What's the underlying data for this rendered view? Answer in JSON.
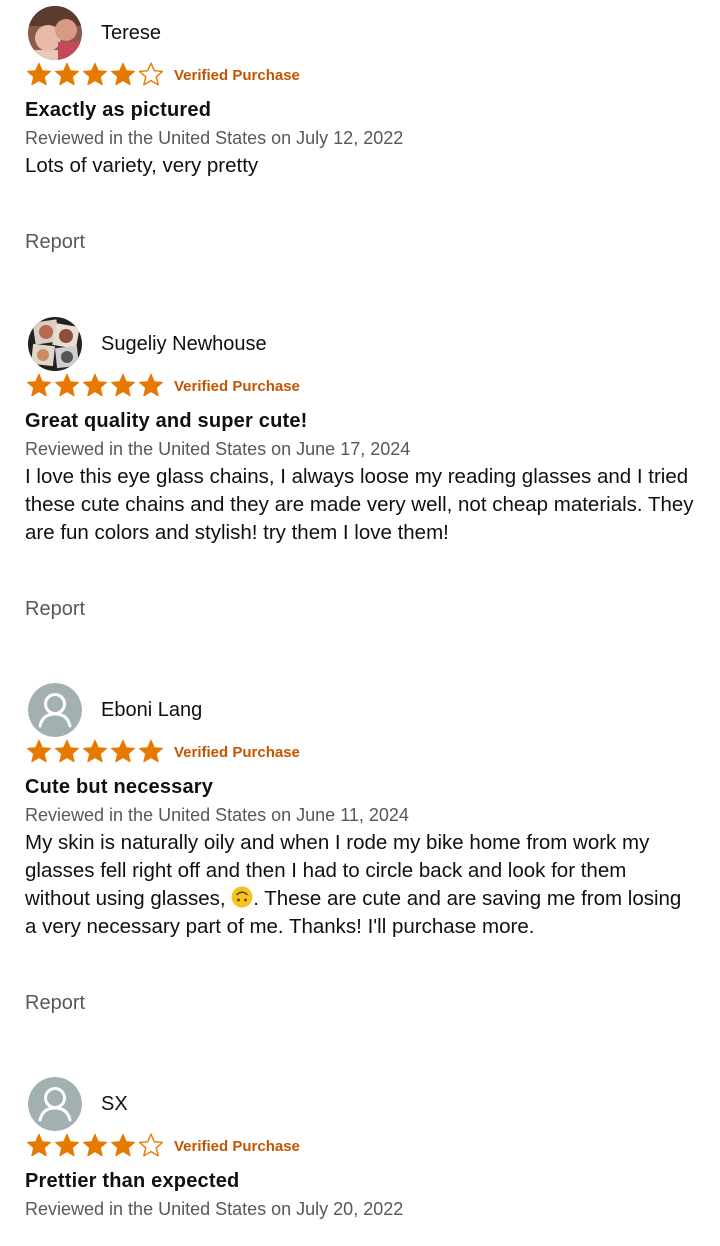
{
  "colors": {
    "star": "#e67a00",
    "verified": "#c45500",
    "secondary_text": "#565959",
    "text": "#0f1111"
  },
  "verified_label": "Verified Purchase",
  "report_label": "Report",
  "reviews": [
    {
      "reviewer": "Terese",
      "avatar": "photo",
      "rating": 4,
      "title": "Exactly as pictured",
      "date": "Reviewed in the United States on July 12, 2022",
      "body": "Lots of variety, very pretty"
    },
    {
      "reviewer": "Sugeliy Newhouse",
      "avatar": "photo",
      "rating": 5,
      "title": "Great quality and super cute!",
      "date": "Reviewed in the United States on June 17, 2024",
      "body": "I love this eye glass chains, I always loose my reading glasses and I tried these cute chains and they are made very well, not cheap materials. They are fun colors and stylish! try them I love them!"
    },
    {
      "reviewer": "Eboni Lang",
      "avatar": "default-user-icon",
      "rating": 5,
      "title": "Cute but necessary",
      "date": "Reviewed in the United States on June 11, 2024",
      "body_before_emoji": "My skin is naturally oily and when I rode my bike home from work my glasses fell right off and then I had to circle back and look for them without using glasses, ",
      "emoji": "upside-down-face-emoji",
      "body_after_emoji": ". These are cute and are saving me from losing a very necessary part of me. Thanks! I'll purchase more."
    },
    {
      "reviewer": "SX",
      "avatar": "default-user-icon",
      "rating": 4,
      "title": "Prettier than expected",
      "date": "Reviewed in the United States on July 20, 2022"
    }
  ]
}
